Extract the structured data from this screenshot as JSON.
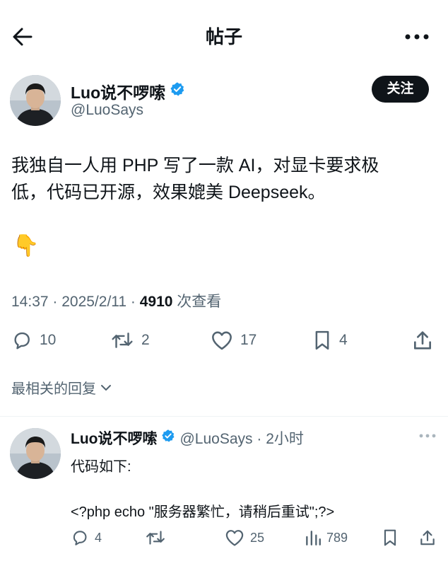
{
  "header": {
    "title": "帖子",
    "back_icon": "arrow-left-icon",
    "more_icon": "more-horizontal-icon"
  },
  "post": {
    "author": {
      "display_name": "Luo说不啰嗦",
      "handle": "@LuoSays",
      "verified_icon": "verified-badge-icon"
    },
    "follow_label": "关注",
    "text_line1": "我独自一人用 PHP 写了一款 AI，对显卡要求极",
    "text_line2": "低，代码已开源，效果媲美 Deepseek。",
    "emoji": "👇",
    "time": "14:37 · 2025/2/11 · ",
    "views_count": "4910",
    "views_label": " 次查看",
    "actions": {
      "reply_count": "10",
      "retweet_count": "2",
      "like_count": "17",
      "bookmark_count": "4"
    }
  },
  "sort_label": "最相关的回复",
  "reply": {
    "display_name": "Luo说不啰嗦",
    "handle_time": "@LuoSays · 2小时",
    "line1": "代码如下:",
    "line2": "<?php echo \"服务器繁忙，请稍后重试\";?>",
    "actions": {
      "reply_count": "4",
      "like_count": "25",
      "view_count": "789"
    }
  },
  "colors": {
    "text": "#0f1419",
    "secondary": "#536471",
    "verified": "#1d9bf0",
    "divider": "#eff3f4"
  }
}
